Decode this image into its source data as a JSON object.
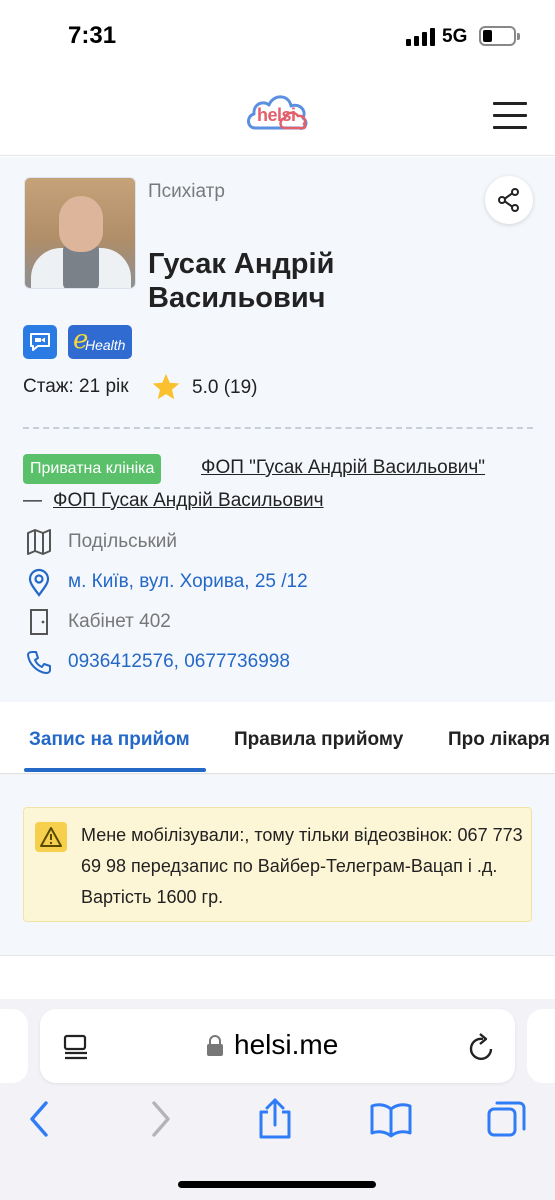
{
  "status_bar": {
    "time": "7:31",
    "network": "5G"
  },
  "header": {
    "logo_text": "helsi"
  },
  "doctor": {
    "specialty": "Психіатр",
    "name": "Гусак Андрій Васильович",
    "experience": "Стаж: 21 рік",
    "rating": "5.0 (19)",
    "badges": {
      "ehealth_e": "e",
      "ehealth_h": "Health"
    }
  },
  "clinic": {
    "type_badge": "Приватна клініка",
    "name": "ФОП \"Гусак Андрій Васильович\"",
    "dash": "—",
    "owner": "ФОП Гусак Андрій Васильович"
  },
  "info": {
    "district": "Подільський",
    "address": "м. Київ, вул. Хорива, 25 /12",
    "cabinet": "Кабінет 402",
    "phones": "0936412576, 0677736998"
  },
  "tabs": [
    {
      "label": "Запис на прийом",
      "active": true
    },
    {
      "label": "Правила прийому",
      "active": false
    },
    {
      "label": "Про лікаря",
      "active": false
    }
  ],
  "notice": {
    "text": "Мене мобілізували:, тому тільки відеозвінок: 067 773 69 98 передзапис по Вайбер-Телеграм-Вацап і .д. Вартість 1600 гр."
  },
  "browser": {
    "url": "helsi.me"
  },
  "colors": {
    "accent": "#2468c8",
    "clinic_badge": "#5ac16a",
    "notice_bg": "#fdf6d6",
    "logo": "#e2606b"
  }
}
